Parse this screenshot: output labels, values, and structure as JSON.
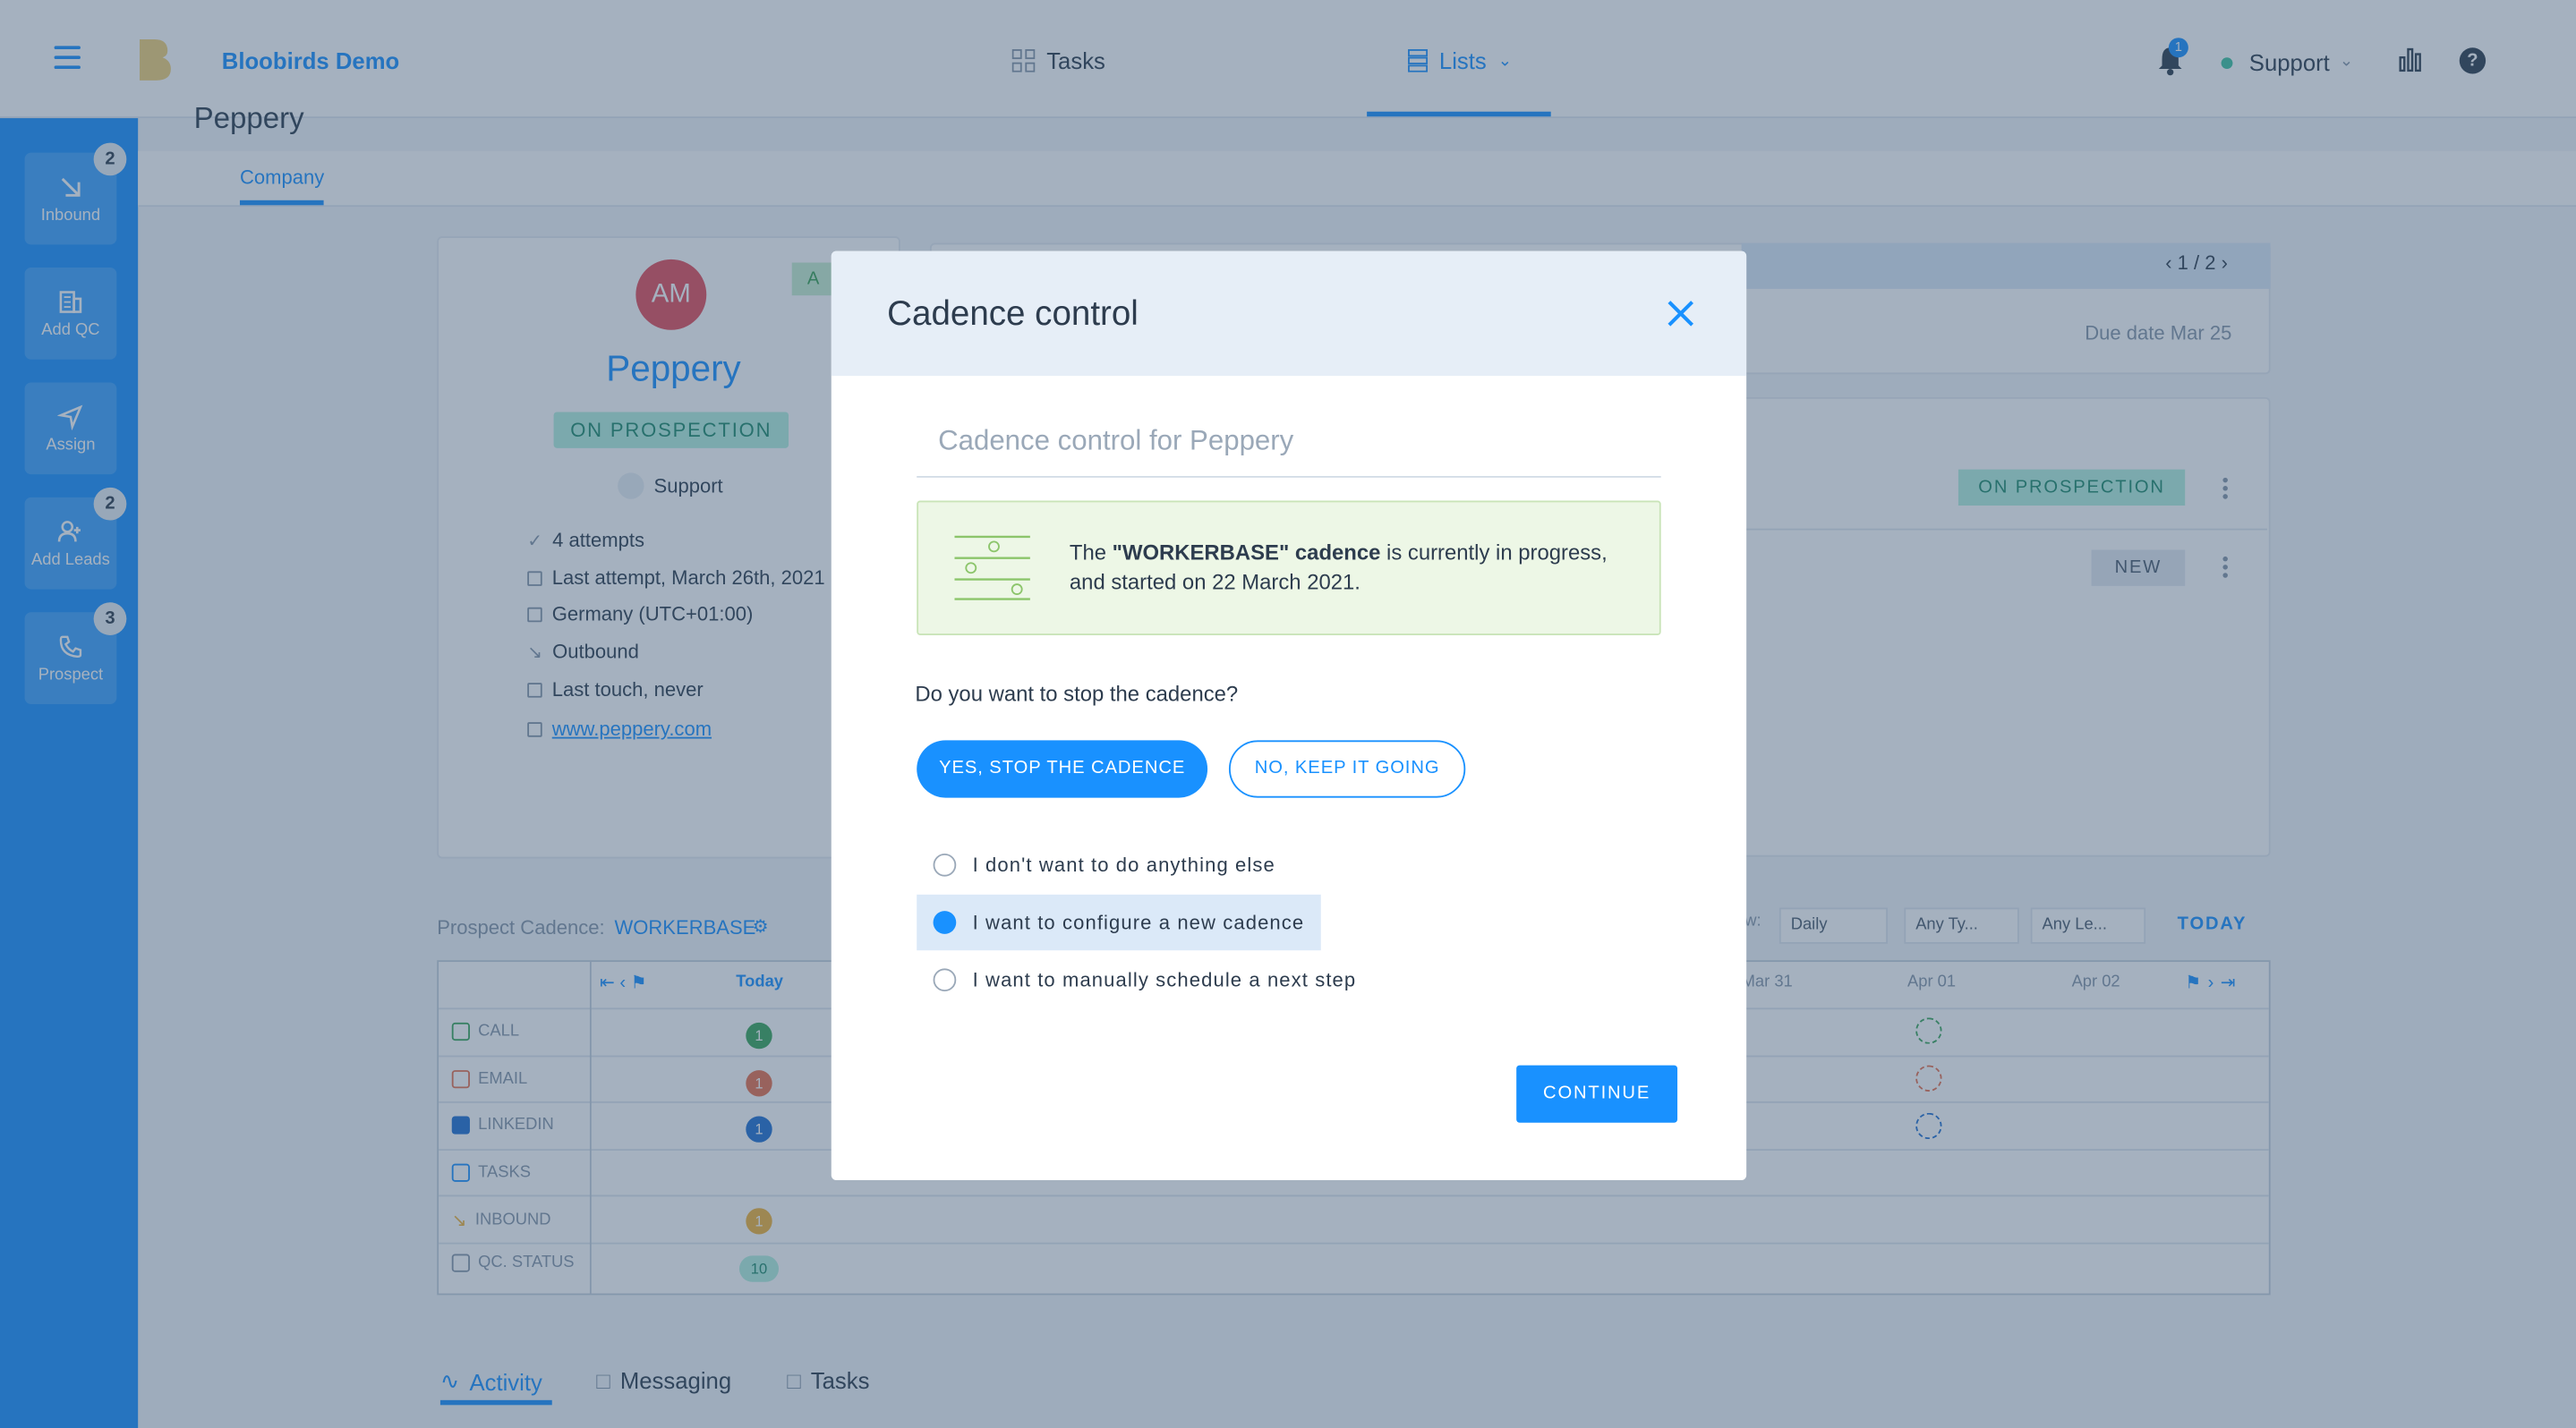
{
  "app": {
    "brand": "Bloobirds Demo",
    "nav": {
      "tasks": "Tasks",
      "lists": "Lists"
    },
    "notifications_count": "1",
    "user": "Support"
  },
  "sidebar": {
    "items": [
      {
        "label": "Inbound",
        "badge": "2",
        "icon": "arrow-down-right-icon"
      },
      {
        "label": "Add QC",
        "badge": "",
        "icon": "building-icon"
      },
      {
        "label": "Assign",
        "badge": "",
        "icon": "send-icon"
      },
      {
        "label": "Add Leads",
        "badge": "2",
        "icon": "add-user-icon"
      },
      {
        "label": "Prospect",
        "badge": "3",
        "icon": "phone-icon"
      }
    ]
  },
  "page": {
    "title": "Peppery",
    "tab": "Company"
  },
  "company": {
    "initials": "AM",
    "name": "Peppery",
    "status": "ON PROSPECTION",
    "tag": "A",
    "owner": "Support",
    "info": [
      {
        "text": "4 attempts",
        "icon": "check-icon"
      },
      {
        "text": "Last attempt, March 26th, 2021",
        "icon": "calendar-icon"
      },
      {
        "text": "Germany (UTC+01:00)",
        "icon": "bookmark-icon"
      },
      {
        "text": "Outbound",
        "icon": "arrow-down-right-icon"
      },
      {
        "text": "Last touch, never",
        "icon": "calendar-icon"
      },
      {
        "text": "www.peppery.com",
        "icon": "external-link-icon"
      }
    ]
  },
  "right_panel": {
    "pager": "1 / 2",
    "due": "Due date Mar 25",
    "status_1": "ON PROSPECTION",
    "status_2": "NEW"
  },
  "cadence": {
    "label": "Prospect Cadence:",
    "name": "WORKERBASE",
    "today": "Today",
    "dates": [
      "Mar 31",
      "Apr 01",
      "Apr 02"
    ],
    "rows": [
      {
        "label": "CALL",
        "color": "#3aa65a",
        "count": "1"
      },
      {
        "label": "EMAIL",
        "color": "#e8704e",
        "count": "1"
      },
      {
        "label": "LINKEDIN",
        "color": "#1f6fd1",
        "count": "1"
      },
      {
        "label": "TASKS",
        "color": "#1991ff",
        "count": ""
      },
      {
        "label": "INBOUND",
        "color": "#f0b33a",
        "count": "1"
      },
      {
        "label": "QC. STATUS",
        "color": "#8595a8",
        "count": "10"
      }
    ],
    "filters": {
      "view_prefix": "w:",
      "view": "Daily",
      "type": "Any Ty...",
      "lead": "Any Le...",
      "today_btn": "TODAY"
    }
  },
  "bottom_tabs": [
    "Activity",
    "Messaging",
    "Tasks"
  ],
  "modal": {
    "title": "Cadence control",
    "subtitle": "Cadence control for Peppery",
    "info_pre": "The ",
    "info_bold": "\"WORKERBASE\" cadence",
    "info_post": " is currently in progress, and started on 22 March 2021.",
    "question": "Do you want to stop the cadence?",
    "stop_btn": "YES, STOP THE CADENCE",
    "keep_btn": "NO, KEEP IT GOING",
    "options": [
      {
        "label": "I don't want to do anything else",
        "selected": false
      },
      {
        "label": "I want to configure a new cadence",
        "selected": true
      },
      {
        "label": "I want to manually schedule a next step",
        "selected": false
      }
    ],
    "continue_btn": "CONTINUE"
  },
  "colors": {
    "accent": "#1991ff",
    "prospection": "#b3f0df",
    "overlay": "rgba(55,82,112,0.45)"
  }
}
